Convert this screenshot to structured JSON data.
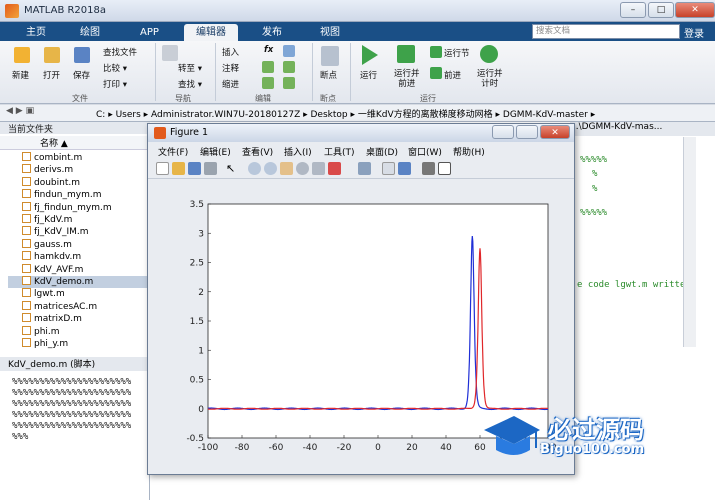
{
  "window": {
    "title": "MATLAB R2018a",
    "min": "–",
    "max": "□",
    "close": "✕"
  },
  "tabs": [
    "主页",
    "绘图",
    "APP",
    "编辑器",
    "发布",
    "视图"
  ],
  "search": {
    "placeholder": "搜索文档"
  },
  "login": "登录",
  "ribbon": {
    "new": "新建",
    "open": "打开",
    "save": "保存",
    "findfile": "查找文件",
    "compare": "比较 ▾",
    "print": "打印 ▾",
    "goto": "转至 ▾",
    "find": "查找 ▾",
    "insert": "插入",
    "comment": "注释",
    "indent": "缩进",
    "fx": "fx",
    "breakpoints": "断点",
    "run": "运行",
    "runadvance": "运行并\n前进",
    "runsection": "运行节",
    "advance": "前进",
    "runtime": "运行并\n计时",
    "groups": [
      "文件",
      "导航",
      "编辑",
      "断点",
      "运行"
    ]
  },
  "address": {
    "path": [
      "C:",
      "Users",
      "Administrator.WIN7U-20180127Z",
      "Desktop",
      "一维KdV方程的离散梯度移动网格",
      "DGMM-KdV-master"
    ]
  },
  "leftpane": {
    "title": "当前文件夹",
    "colname": "名称 ▲",
    "files": [
      "combint.m",
      "derivs.m",
      "doubint.m",
      "findun_mym.m",
      "fj_findun_mym.m",
      "fj_KdV.m",
      "fj_KdV_IM.m",
      "gauss.m",
      "hamkdv.m",
      "KdV_AVF.m",
      "KdV_demo.m",
      "lgwt.m",
      "matricesAC.m",
      "matrixD.m",
      "phi.m",
      "phi_y.m"
    ],
    "selected": "KdV_demo.m"
  },
  "bottompane": {
    "title": "KdV_demo.m  (脚本)",
    "lines": [
      "%%%%%%%%%%%%%%%%%%%%%%",
      "%%%%%%%%%%%%%%%%%%%%%%",
      "%%%%%%%%%%%%%%%%%%%%%%",
      "%%%%%%%%%%%%%%%%%%%%%%",
      "%%%%%%%%%%%%%%%%%%%%%%",
      "%%%"
    ]
  },
  "editor": {
    "tab": "...\\DGMM-KdV-mas...",
    "code": [
      "%%%%%",
      "%",
      "%",
      "%%%%%",
      "e code lgwt.m writte"
    ]
  },
  "figure": {
    "title": "Figure 1",
    "menu": [
      "文件(F)",
      "编辑(E)",
      "查看(V)",
      "插入(I)",
      "工具(T)",
      "桌面(D)",
      "窗口(W)",
      "帮助(H)"
    ]
  },
  "chart_data": {
    "type": "line",
    "title": "",
    "xlabel": "",
    "ylabel": "",
    "xlim": [
      -100,
      100
    ],
    "ylim": [
      -0.5,
      3.5
    ],
    "xticks": [
      -100,
      -80,
      -60,
      -40,
      -20,
      0,
      20,
      40,
      60,
      80,
      100
    ],
    "yticks": [
      -0.5,
      0,
      0.5,
      1,
      1.5,
      2,
      2.5,
      3,
      3.5
    ],
    "series": [
      {
        "color": "#1f2fd6",
        "peak_x": 55.5,
        "peak_y": 2.95,
        "width": 1.4
      },
      {
        "color": "#e0272a",
        "peak_x": 60,
        "peak_y": 2.75,
        "width": 1.4
      }
    ]
  },
  "watermark": {
    "title": "必过源码",
    "url": "Biguo100.com"
  },
  "colors": {
    "ribbon_blue": "#1a4f86",
    "accent": "#d67a1a"
  }
}
